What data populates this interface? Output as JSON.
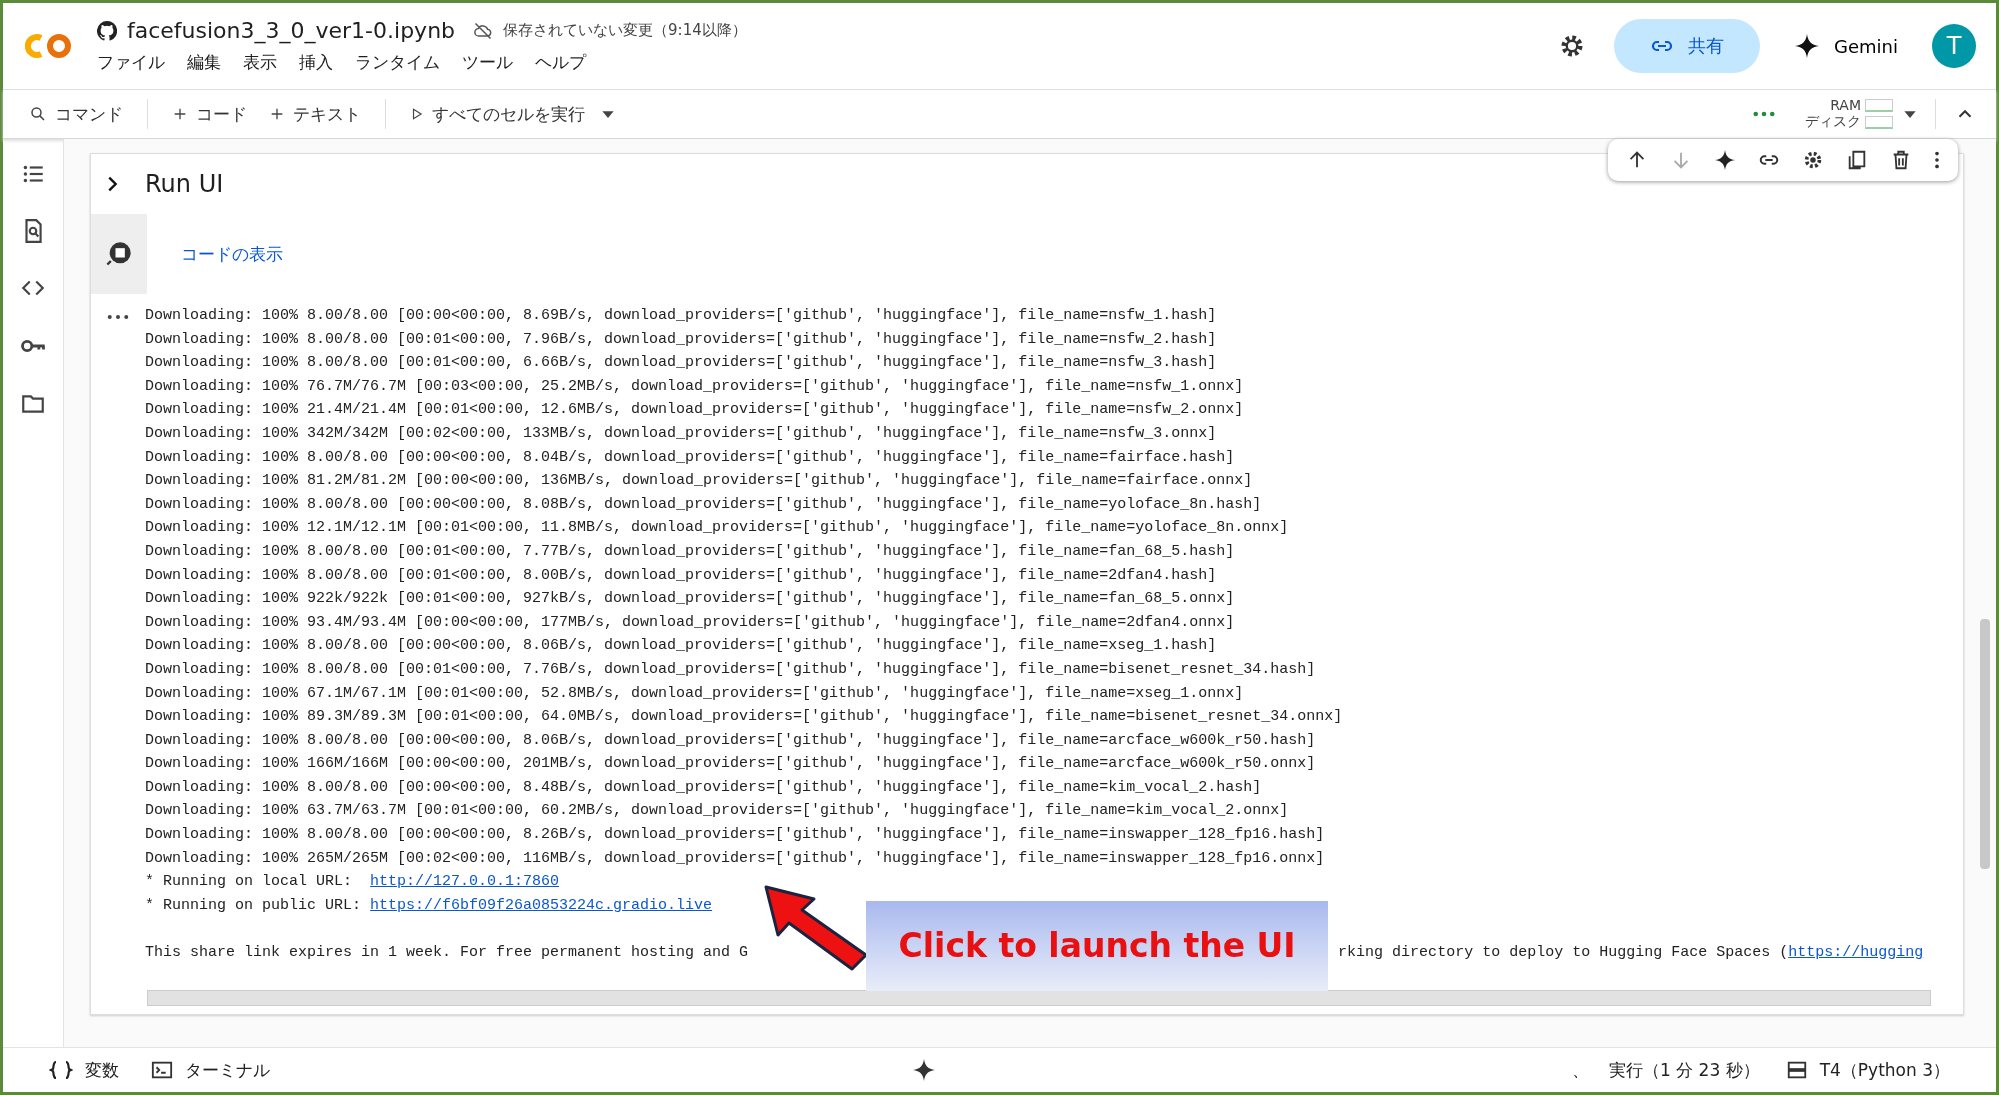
{
  "header": {
    "notebook_title": "facefusion3_3_0_ver1-0.ipynb",
    "save_status": "保存されていない変更（9:14以降）",
    "menu": [
      "ファイル",
      "編集",
      "表示",
      "挿入",
      "ランタイム",
      "ツール",
      "ヘルプ"
    ],
    "share_button": "共有",
    "gemini_button": "Gemini",
    "avatar_initial": "T"
  },
  "toolbar": {
    "command": "コマンド",
    "add_code": "コード",
    "add_text": "テキスト",
    "run_all": "すべてのセルを実行",
    "ram_label": "RAM",
    "disk_label": "ディスク"
  },
  "cell": {
    "title": "Run UI",
    "show_code_link": "コードの表示",
    "output_lines": [
      "Downloading: 100% 8.00/8.00 [00:00<00:00, 8.69B/s, download_providers=['github', 'huggingface'], file_name=nsfw_1.hash]",
      "Downloading: 100% 8.00/8.00 [00:01<00:00, 7.96B/s, download_providers=['github', 'huggingface'], file_name=nsfw_2.hash]",
      "Downloading: 100% 8.00/8.00 [00:01<00:00, 6.66B/s, download_providers=['github', 'huggingface'], file_name=nsfw_3.hash]",
      "Downloading: 100% 76.7M/76.7M [00:03<00:00, 25.2MB/s, download_providers=['github', 'huggingface'], file_name=nsfw_1.onnx]",
      "Downloading: 100% 21.4M/21.4M [00:01<00:00, 12.6MB/s, download_providers=['github', 'huggingface'], file_name=nsfw_2.onnx]",
      "Downloading: 100% 342M/342M [00:02<00:00, 133MB/s, download_providers=['github', 'huggingface'], file_name=nsfw_3.onnx]",
      "Downloading: 100% 8.00/8.00 [00:00<00:00, 8.04B/s, download_providers=['github', 'huggingface'], file_name=fairface.hash]",
      "Downloading: 100% 81.2M/81.2M [00:00<00:00, 136MB/s, download_providers=['github', 'huggingface'], file_name=fairface.onnx]",
      "Downloading: 100% 8.00/8.00 [00:00<00:00, 8.08B/s, download_providers=['github', 'huggingface'], file_name=yoloface_8n.hash]",
      "Downloading: 100% 12.1M/12.1M [00:01<00:00, 11.8MB/s, download_providers=['github', 'huggingface'], file_name=yoloface_8n.onnx]",
      "Downloading: 100% 8.00/8.00 [00:01<00:00, 7.77B/s, download_providers=['github', 'huggingface'], file_name=fan_68_5.hash]",
      "Downloading: 100% 8.00/8.00 [00:01<00:00, 8.00B/s, download_providers=['github', 'huggingface'], file_name=2dfan4.hash]",
      "Downloading: 100% 922k/922k [00:01<00:00, 927kB/s, download_providers=['github', 'huggingface'], file_name=fan_68_5.onnx]",
      "Downloading: 100% 93.4M/93.4M [00:00<00:00, 177MB/s, download_providers=['github', 'huggingface'], file_name=2dfan4.onnx]",
      "Downloading: 100% 8.00/8.00 [00:00<00:00, 8.06B/s, download_providers=['github', 'huggingface'], file_name=xseg_1.hash]",
      "Downloading: 100% 8.00/8.00 [00:01<00:00, 7.76B/s, download_providers=['github', 'huggingface'], file_name=bisenet_resnet_34.hash]",
      "Downloading: 100% 67.1M/67.1M [00:01<00:00, 52.8MB/s, download_providers=['github', 'huggingface'], file_name=xseg_1.onnx]",
      "Downloading: 100% 89.3M/89.3M [00:01<00:00, 64.0MB/s, download_providers=['github', 'huggingface'], file_name=bisenet_resnet_34.onnx]",
      "Downloading: 100% 8.00/8.00 [00:00<00:00, 8.06B/s, download_providers=['github', 'huggingface'], file_name=arcface_w600k_r50.hash]",
      "Downloading: 100% 166M/166M [00:00<00:00, 201MB/s, download_providers=['github', 'huggingface'], file_name=arcface_w600k_r50.onnx]",
      "Downloading: 100% 8.00/8.00 [00:00<00:00, 8.48B/s, download_providers=['github', 'huggingface'], file_name=kim_vocal_2.hash]",
      "Downloading: 100% 63.7M/63.7M [00:01<00:00, 60.2MB/s, download_providers=['github', 'huggingface'], file_name=kim_vocal_2.onnx]",
      "Downloading: 100% 8.00/8.00 [00:00<00:00, 8.26B/s, download_providers=['github', 'huggingface'], file_name=inswapper_128_fp16.hash]",
      "Downloading: 100% 265M/265M [00:02<00:00, 116MB/s, download_providers=['github', 'huggingface'], file_name=inswapper_128_fp16.onnx]"
    ],
    "urls": [
      {
        "label": "* Running on local URL:  ",
        "url": "http://127.0.0.1:7860"
      },
      {
        "label": "* Running on public URL: ",
        "url": "https://f6bf09f26a0853224c.gradio.live"
      }
    ],
    "share_note": {
      "text_before": "This share link expires in 1 week. For free permanent hosting and G",
      "text_after": "rking directory to deploy to Hugging Face Spaces (",
      "link": "https://hugging"
    }
  },
  "callout": {
    "text": "Click to launch the UI"
  },
  "status_bar": {
    "variables": "変数",
    "terminal": "ターミナル",
    "separator": "、",
    "execution": "実行（1 分 23 秒）",
    "runtime": "T4（Python 3）"
  }
}
